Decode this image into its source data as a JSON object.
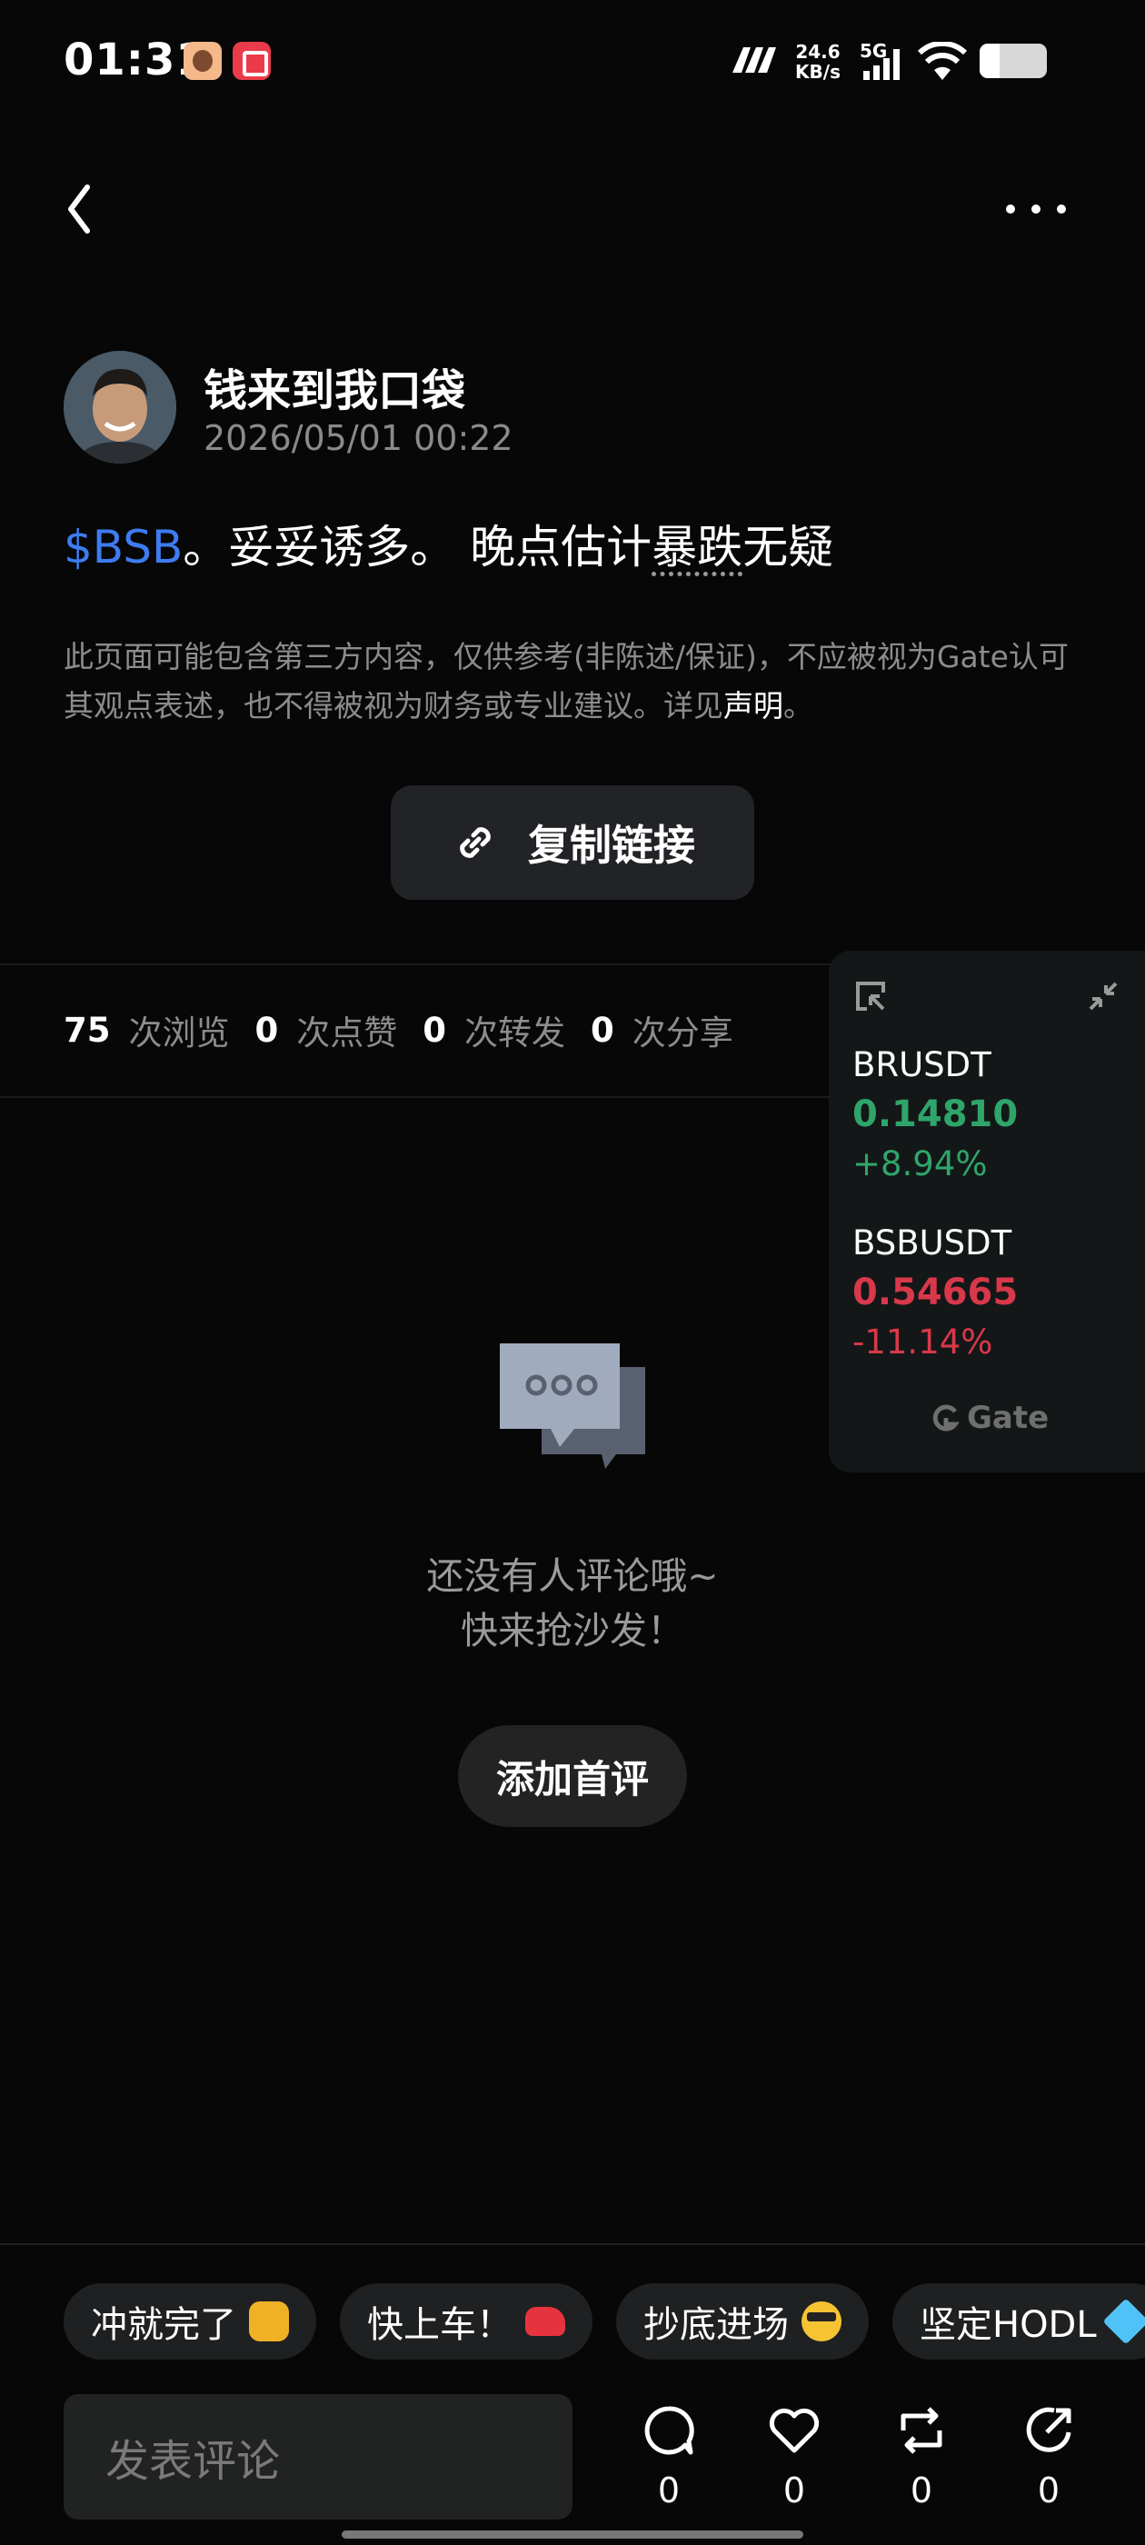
{
  "status_bar": {
    "time": "01:31",
    "net_speed_value": "24.6",
    "net_speed_unit": "KB/s",
    "network_type": "5G",
    "battery_level": 0.3
  },
  "post": {
    "author_name": "钱来到我口袋",
    "timestamp": "2026/05/01 00:22",
    "ticker": "$BSB",
    "text_part1": "。妥妥诱多。 晚点估计",
    "text_dotted": "暴跌",
    "text_part2": "无疑"
  },
  "disclaimer": {
    "text": "此页面可能包含第三方内容，仅供参考(非陈述/保证)，不应被视为Gate认可其观点表述，也不得被视为财务或专业建议。详见",
    "link": "声明",
    "end": "。"
  },
  "copy_link": {
    "label": "复制链接"
  },
  "stats": [
    {
      "count": "75",
      "label": "次浏览"
    },
    {
      "count": "0",
      "label": "次点赞"
    },
    {
      "count": "0",
      "label": "次转发"
    },
    {
      "count": "0",
      "label": "次分享"
    }
  ],
  "price_widget": {
    "brand": "Gate",
    "items": [
      {
        "symbol": "BRUSDT",
        "price": "0.14810",
        "change": "+8.94%",
        "direction": "up"
      },
      {
        "symbol": "BSBUSDT",
        "price": "0.54665",
        "change": "-11.14%",
        "direction": "down"
      }
    ],
    "colors": {
      "up": "#2fa56b",
      "down": "#d9384a"
    }
  },
  "empty_state": {
    "line1": "还没有人评论哦~",
    "line2": "快来抢沙发！",
    "button_label": "添加首评"
  },
  "quick_replies": [
    {
      "label": "冲就完了",
      "emoji": "fist"
    },
    {
      "label": "快上车！",
      "emoji": "car"
    },
    {
      "label": "抄底进场",
      "emoji": "cool"
    },
    {
      "label": "坚定HODL",
      "emoji": "gem"
    }
  ],
  "comment_bar": {
    "placeholder": "发表评论",
    "actions": [
      {
        "name": "comment",
        "count": "0"
      },
      {
        "name": "like",
        "count": "0"
      },
      {
        "name": "repost",
        "count": "0"
      },
      {
        "name": "share",
        "count": "0"
      }
    ]
  }
}
